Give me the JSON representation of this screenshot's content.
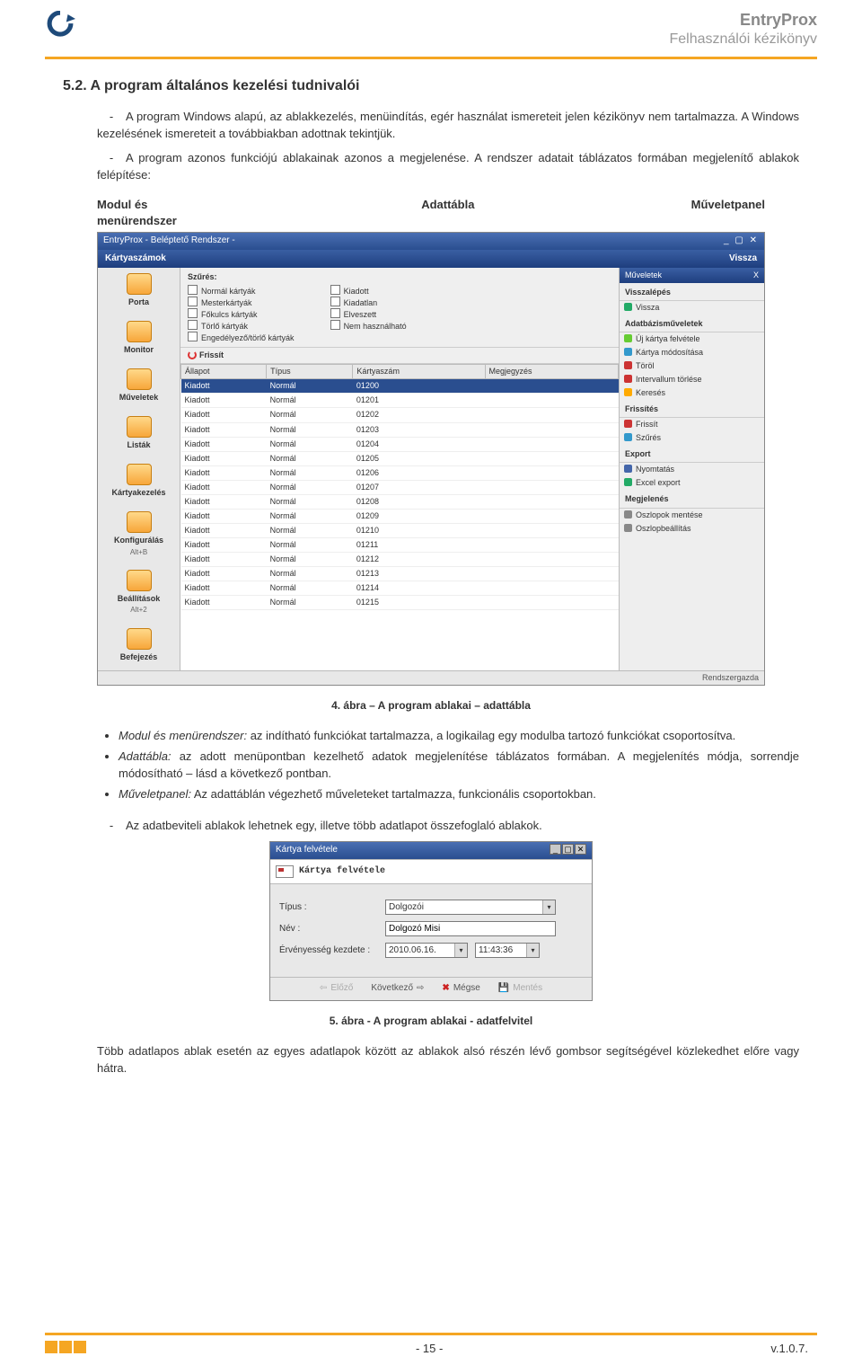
{
  "header": {
    "product": "EntryProx",
    "subtitle": "Felhasználói kézikönyv"
  },
  "section": {
    "number_title": "5.2.  A program általános kezelési tudnivalói",
    "p1": "A program Windows alapú, az ablakkezelés, menüindítás, egér használat ismereteit jelen kézikönyv nem tartalmazza. A Windows kezelésének ismereteit a továbbiakban adottnak tekintjük.",
    "p2": "A program azonos funkciójú ablakainak azonos a megjelenése. A rendszer adatait táblázatos formában megjelenítő ablakok felépítése:",
    "labels": {
      "left": "Modul és menürendszer",
      "mid": "Adattábla",
      "right": "Műveletpanel"
    }
  },
  "shot1": {
    "window_title": "EntryProx - Beléptető Rendszer  -",
    "blue_title": "Kártyaszámok",
    "blue_right": "Vissza",
    "sidebar": [
      {
        "label": "Porta",
        "sc": ""
      },
      {
        "label": "Monitor",
        "sc": ""
      },
      {
        "label": "Műveletek",
        "sc": ""
      },
      {
        "label": "Listák",
        "sc": ""
      },
      {
        "label": "Kártyakezelés",
        "sc": ""
      },
      {
        "label": "Konfigurálás",
        "sc": "Alt+B"
      },
      {
        "label": "Beállítások",
        "sc": "Alt+2"
      },
      {
        "label": "Befejezés",
        "sc": ""
      }
    ],
    "filters_title": "Szűrés:",
    "filters_left": [
      "Normál kártyák",
      "Mesterkártyák",
      "Főkulcs kártyák",
      "Törlő kártyák",
      "Engedélyező/törlő kártyák"
    ],
    "filters_right": [
      "Kiadott",
      "Kiadatlan",
      "Elveszett",
      "Nem használható"
    ],
    "refresh_label": "Frissít",
    "table_headers": [
      "Állapot",
      "Típus",
      "Kártyaszám",
      "Megjegyzés"
    ],
    "rows": [
      [
        "Kiadott",
        "Normál",
        "01200",
        ""
      ],
      [
        "Kiadott",
        "Normál",
        "01201",
        ""
      ],
      [
        "Kiadott",
        "Normál",
        "01202",
        ""
      ],
      [
        "Kiadott",
        "Normál",
        "01203",
        ""
      ],
      [
        "Kiadott",
        "Normál",
        "01204",
        ""
      ],
      [
        "Kiadott",
        "Normál",
        "01205",
        ""
      ],
      [
        "Kiadott",
        "Normál",
        "01206",
        ""
      ],
      [
        "Kiadott",
        "Normál",
        "01207",
        ""
      ],
      [
        "Kiadott",
        "Normál",
        "01208",
        ""
      ],
      [
        "Kiadott",
        "Normál",
        "01209",
        ""
      ],
      [
        "Kiadott",
        "Normál",
        "01210",
        ""
      ],
      [
        "Kiadott",
        "Normál",
        "01211",
        ""
      ],
      [
        "Kiadott",
        "Normál",
        "01212",
        ""
      ],
      [
        "Kiadott",
        "Normál",
        "01213",
        ""
      ],
      [
        "Kiadott",
        "Normál",
        "01214",
        ""
      ],
      [
        "Kiadott",
        "Normál",
        "01215",
        ""
      ]
    ],
    "ops": {
      "header": "Műveletek",
      "header_x": "X",
      "back_title": "Visszalépés",
      "back_item": "Vissza",
      "db_title": "Adatbázisműveletek",
      "db_items": [
        "Új kártya felvétele",
        "Kártya módosítása",
        "Töröl",
        "Intervallum törlése",
        "Keresés"
      ],
      "refresh_title": "Frissítés",
      "refresh_items": [
        "Frissít",
        "Szűrés"
      ],
      "export_title": "Export",
      "export_items": [
        "Nyomtatás",
        "Excel export"
      ],
      "view_title": "Megjelenés",
      "view_items": [
        "Oszlopok mentése",
        "Oszlopbeállítás"
      ]
    },
    "statusbar": "Rendszergazda"
  },
  "caption1": "4. ábra – A program ablakai – adattábla",
  "bullets": {
    "b1_it": "Modul és menürendszer:",
    "b1": " az indítható funkciókat tartalmazza, a logikailag egy modulba tartozó funkciókat csoportosítva.",
    "b2_it": "Adattábla:",
    "b2": " az adott menüpontban kezelhető adatok megjelenítése táblázatos formában. A megjelenítés módja, sorrendje módosítható – lásd a következő pontban.",
    "b3_it": "Műveletpanel:",
    "b3": " Az adattáblán végezhető műveleteket tartalmazza, funkcionális csoportokban."
  },
  "p3": "Az adatbeviteli ablakok lehetnek egy, illetve több adatlapot összefoglaló ablakok.",
  "shot2": {
    "title": "Kártya felvétele",
    "band": "Kártya felvétele",
    "f_type_lbl": "Típus :",
    "f_type_val": "Dolgozói",
    "f_name_lbl": "Név :",
    "f_name_val": "Dolgozó Misi",
    "f_valid_lbl": "Érvényesség kezdete :",
    "f_valid_date": "2010.06.16.",
    "f_valid_time": "11:43:36",
    "btns": {
      "prev": "Előző",
      "next": "Következő",
      "cancel": "Mégse",
      "save": "Mentés"
    }
  },
  "caption2": "5. ábra - A program ablakai - adatfelvitel",
  "p4": "Több adatlapos ablak esetén az egyes adatlapok között az ablakok alsó részén lévő gombsor segítségével közlekedhet előre vagy hátra.",
  "footer": {
    "page": "- 15 -",
    "version": "v.1.0.7."
  }
}
